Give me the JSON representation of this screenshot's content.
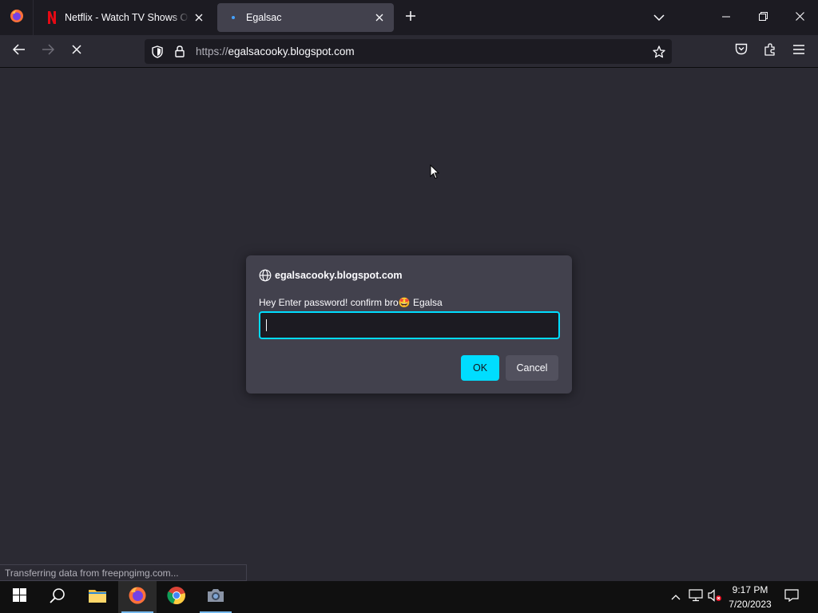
{
  "tabs": [
    {
      "title": "Netflix - Watch TV Shows Online, Watch Movies Online",
      "favicon": "netflix-icon",
      "active": false
    },
    {
      "title": "Egalsac",
      "favicon": "loading-dot-icon",
      "active": true
    }
  ],
  "url": {
    "scheme": "https://",
    "host": "egalsacooky.blogspot.com"
  },
  "dialog": {
    "origin": "egalsacooky.blogspot.com",
    "message": "Hey Enter password! confirm bro🤩 Egalsa",
    "input_value": "",
    "ok_label": "OK",
    "cancel_label": "Cancel"
  },
  "status_text": "Transferring data from freepngimg.com...",
  "taskbar": {
    "apps": [
      "windows-start-icon",
      "search-icon",
      "file-explorer-icon",
      "firefox-icon",
      "chrome-icon",
      "camera-icon"
    ],
    "time": "9:17 PM",
    "date": "7/20/2023"
  },
  "colors": {
    "accent": "#00ddff",
    "background": "#2b2a33",
    "dialog": "#42414d"
  }
}
